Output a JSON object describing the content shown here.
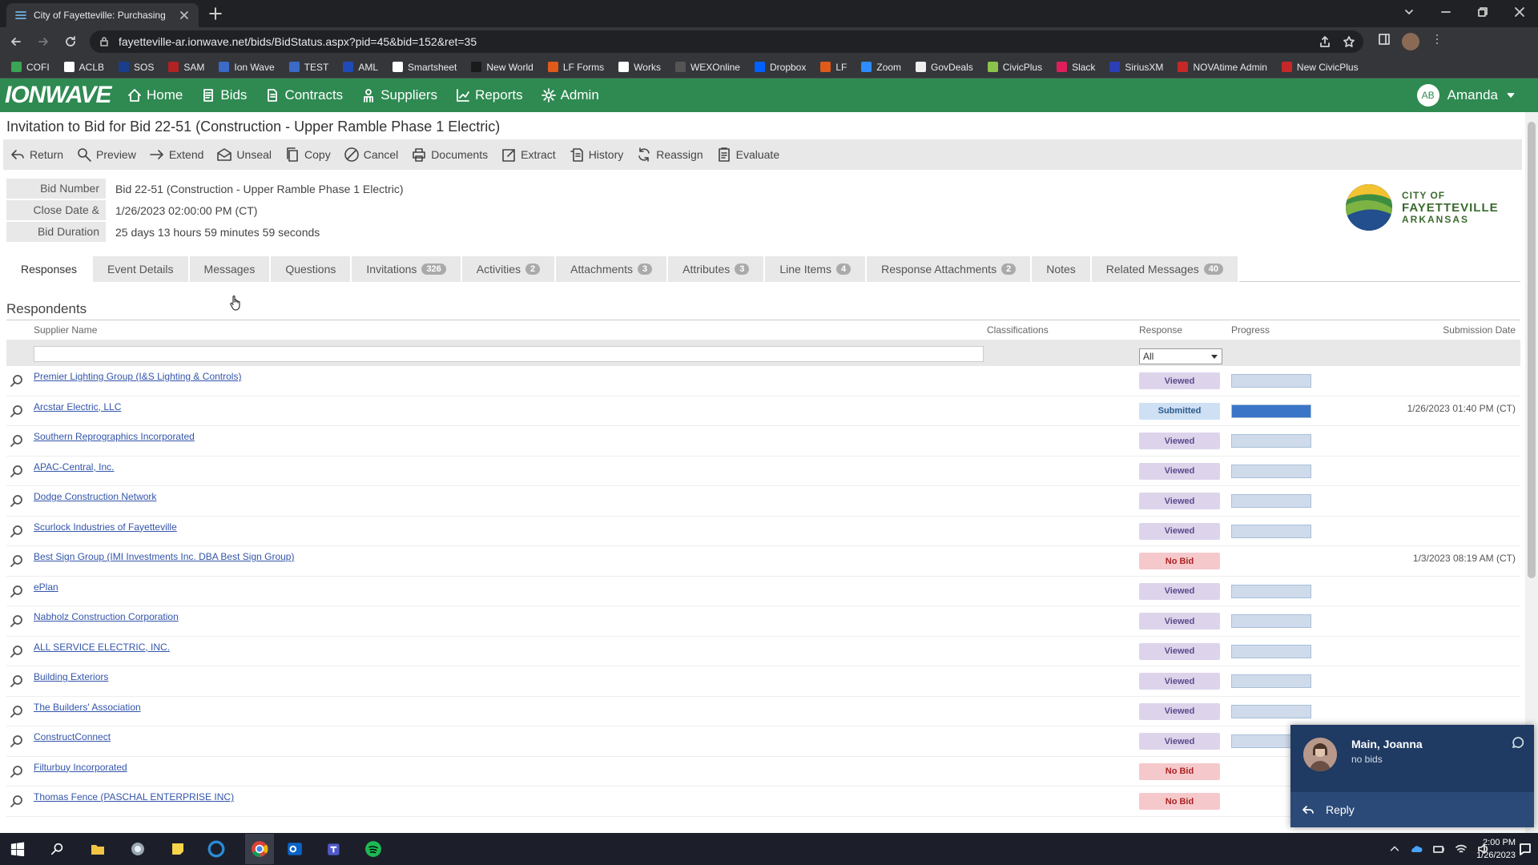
{
  "browser": {
    "tab_title": "City of Fayetteville: Purchasing",
    "url": "fayetteville-ar.ionwave.net/bids/BidStatus.aspx?pid=45&bid=152&ret=35",
    "bookmarks": [
      {
        "label": "COFI",
        "color": "#3aa655"
      },
      {
        "label": "ACLB",
        "color": "#ffffff"
      },
      {
        "label": "SOS",
        "color": "#1a3e8c"
      },
      {
        "label": "SAM",
        "color": "#b22222"
      },
      {
        "label": "Ion Wave",
        "color": "#3b6ac8"
      },
      {
        "label": "TEST",
        "color": "#3b6ac8"
      },
      {
        "label": "AML",
        "color": "#1f4bb8"
      },
      {
        "label": "Smartsheet",
        "color": "#ffffff"
      },
      {
        "label": "New World",
        "color": "#1a1a1a"
      },
      {
        "label": "LF Forms",
        "color": "#e05a1a"
      },
      {
        "label": "Works",
        "color": "#ffffff"
      },
      {
        "label": "WEXOnline",
        "color": "#555555"
      },
      {
        "label": "Dropbox",
        "color": "#0061fe"
      },
      {
        "label": "LF",
        "color": "#e05a1a"
      },
      {
        "label": "Zoom",
        "color": "#2d8cff"
      },
      {
        "label": "GovDeals",
        "color": "#eeeeee"
      },
      {
        "label": "CivicPlus",
        "color": "#8bc34a"
      },
      {
        "label": "Slack",
        "color": "#e01e5a"
      },
      {
        "label": "SiriusXM",
        "color": "#2a3fb8"
      },
      {
        "label": "NOVAtime Admin",
        "color": "#c62828"
      },
      {
        "label": "New CivicPlus",
        "color": "#c62828"
      }
    ]
  },
  "app": {
    "logo": "IONWAVE",
    "nav": [
      "Home",
      "Bids",
      "Contracts",
      "Suppliers",
      "Reports",
      "Admin"
    ],
    "user_initials": "AB",
    "user_name": "Amanda"
  },
  "page": {
    "title": "Invitation to Bid for Bid 22-51 (Construction - Upper Ramble Phase 1 Electric)",
    "toolbar": [
      "Return",
      "Preview",
      "Extend",
      "Unseal",
      "Copy",
      "Cancel",
      "Documents",
      "Extract",
      "History",
      "Reassign",
      "Evaluate"
    ],
    "info": [
      {
        "label": "Bid Number",
        "value": "Bid 22-51 (Construction - Upper Ramble Phase 1 Electric)"
      },
      {
        "label": "Close Date & Time",
        "value": "1/26/2023 02:00:00 PM (CT)"
      },
      {
        "label": "Bid Duration",
        "value": "25 days 13 hours 59 minutes 59 seconds"
      }
    ],
    "city_logo": {
      "line1": "CITY OF",
      "line2": "FAYETTEVILLE",
      "line3": "ARKANSAS"
    },
    "tabs": [
      {
        "label": "Responses",
        "count": ""
      },
      {
        "label": "Event Details",
        "count": ""
      },
      {
        "label": "Messages",
        "count": ""
      },
      {
        "label": "Questions",
        "count": ""
      },
      {
        "label": "Invitations",
        "count": "326"
      },
      {
        "label": "Activities",
        "count": "2"
      },
      {
        "label": "Attachments",
        "count": "3"
      },
      {
        "label": "Attributes",
        "count": "3"
      },
      {
        "label": "Line Items",
        "count": "4"
      },
      {
        "label": "Response Attachments",
        "count": "2"
      },
      {
        "label": "Notes",
        "count": ""
      },
      {
        "label": "Related Messages",
        "count": "40"
      }
    ],
    "section_title": "Respondents",
    "columns": {
      "supplier": "Supplier Name",
      "classifications": "Classifications",
      "response": "Response",
      "progress": "Progress",
      "submission": "Submission Date"
    },
    "response_filter": "All",
    "rows": [
      {
        "name": "Premier Lighting Group (I&S Lighting & Controls)",
        "response": "Viewed",
        "progress": 0,
        "date": ""
      },
      {
        "name": "Arcstar Electric, LLC",
        "response": "Submitted",
        "progress": 1,
        "date": "1/26/2023 01:40 PM (CT)"
      },
      {
        "name": "Southern Reprographics Incorporated",
        "response": "Viewed",
        "progress": 0,
        "date": ""
      },
      {
        "name": "APAC-Central, Inc.",
        "response": "Viewed",
        "progress": 0,
        "date": ""
      },
      {
        "name": "Dodge Construction Network",
        "response": "Viewed",
        "progress": 0,
        "date": ""
      },
      {
        "name": "Scurlock Industries of Fayetteville",
        "response": "Viewed",
        "progress": 0,
        "date": ""
      },
      {
        "name": "Best Sign Group (IMI Investments Inc. DBA Best Sign Group)",
        "response": "No Bid",
        "progress": null,
        "date": "1/3/2023 08:19 AM (CT)"
      },
      {
        "name": "ePlan",
        "response": "Viewed",
        "progress": 0,
        "date": ""
      },
      {
        "name": "Nabholz Construction Corporation",
        "response": "Viewed",
        "progress": 0,
        "date": ""
      },
      {
        "name": "ALL SERVICE ELECTRIC, INC.",
        "response": "Viewed",
        "progress": 0,
        "date": ""
      },
      {
        "name": "Building Exteriors",
        "response": "Viewed",
        "progress": 0,
        "date": ""
      },
      {
        "name": "The Builders' Association",
        "response": "Viewed",
        "progress": 0,
        "date": ""
      },
      {
        "name": "ConstructConnect",
        "response": "Viewed",
        "progress": 0,
        "date": ""
      },
      {
        "name": "Filturbuy Incorporated",
        "response": "No Bid",
        "progress": null,
        "date": ""
      },
      {
        "name": "Thomas Fence (PASCHAL ENTERPRISE INC)",
        "response": "No Bid",
        "progress": null,
        "date": ""
      }
    ]
  },
  "notification": {
    "name": "Main, Joanna",
    "message": "no bids",
    "reply": "Reply"
  },
  "taskbar": {
    "time": "2:00 PM",
    "date": "1/26/2023"
  }
}
